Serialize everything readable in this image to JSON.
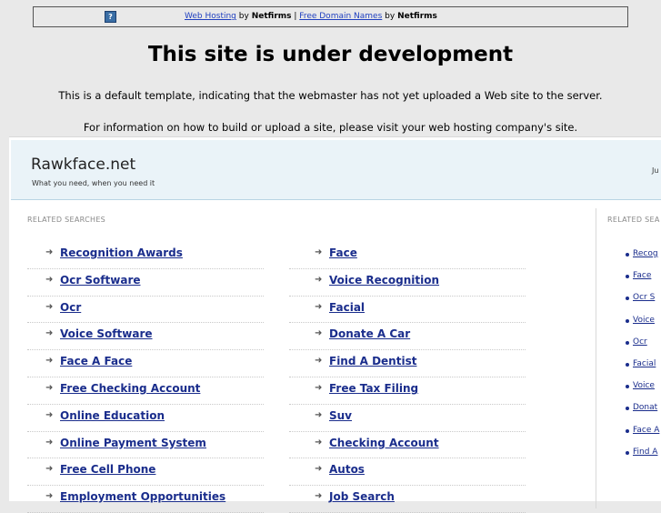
{
  "topbar": {
    "link1": "Web Hosting",
    "by1": "by",
    "brand1": "Netfirms",
    "sep": "|",
    "link2": "Free Domain Names",
    "by2": "by",
    "brand2": "Netfirms"
  },
  "headline": "This site is under development",
  "message1": "This is a default template, indicating that the webmaster has not yet uploaded a Web site to the server.",
  "message2": "For information on how to build or upload a site, please visit your web hosting company's site.",
  "site": {
    "title": "Rawkface.net",
    "tagline": "What you need, when you need it",
    "header_right": "Ju"
  },
  "related": {
    "label": "RELATED SEARCHES",
    "left": [
      "Recognition Awards",
      "Ocr Software",
      "Ocr",
      "Voice Software",
      "Face A Face",
      "Free Checking Account",
      "Online Education",
      "Online Payment System",
      "Free Cell Phone",
      "Employment Opportunities"
    ],
    "right": [
      "Face",
      "Voice Recognition",
      "Facial",
      "Donate A Car",
      "Find A Dentist",
      "Free Tax Filing",
      "Suv",
      "Checking Account",
      "Autos",
      "Job Search"
    ]
  },
  "sidebar": {
    "label": "RELATED SEA",
    "items": [
      "Recog",
      "Face",
      "Ocr S",
      "Voice",
      "Ocr",
      "Facial",
      "Voice",
      "Donat",
      "Face A",
      "Find A"
    ]
  }
}
